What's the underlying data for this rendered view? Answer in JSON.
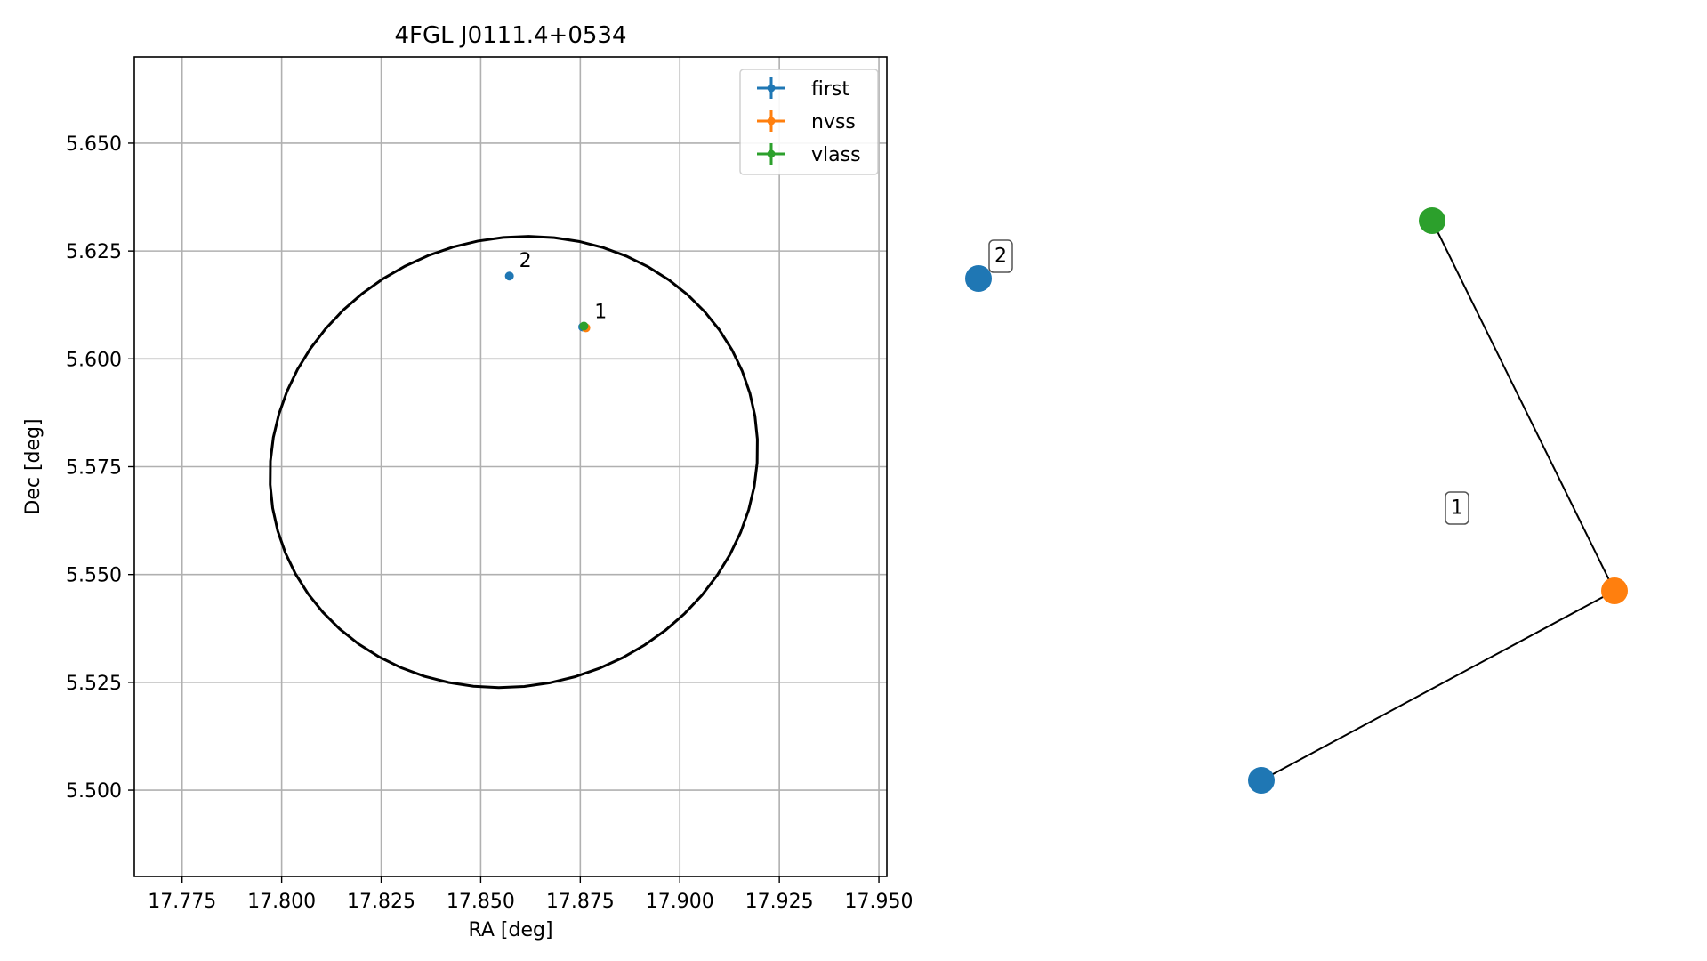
{
  "chart_data": [
    {
      "type": "scatter",
      "title": "4FGL J0111.4+0534",
      "xlabel": "RA [deg]",
      "ylabel": "Dec [deg]",
      "xlim": [
        17.763,
        17.952
      ],
      "ylim": [
        5.48,
        5.67
      ],
      "xticks": [
        17.775,
        17.8,
        17.825,
        17.85,
        17.875,
        17.9,
        17.925,
        17.95
      ],
      "xtick_labels": [
        "17.775",
        "17.800",
        "17.825",
        "17.850",
        "17.875",
        "17.900",
        "17.925",
        "17.950"
      ],
      "yticks": [
        5.5,
        5.525,
        5.55,
        5.575,
        5.6,
        5.625,
        5.65
      ],
      "ytick_labels": [
        "5.500",
        "5.525",
        "5.550",
        "5.575",
        "5.600",
        "5.625",
        "5.650"
      ],
      "grid": true,
      "legend_position": "top-right",
      "series": [
        {
          "name": "first",
          "color": "#1f77b4",
          "points": [
            {
              "x": 17.8572,
              "y": 5.6192
            },
            {
              "x": 17.8756,
              "y": 5.6074
            }
          ]
        },
        {
          "name": "nvss",
          "color": "#ff7f0e",
          "points": [
            {
              "x": 17.8764,
              "y": 5.6072
            }
          ]
        },
        {
          "name": "vlass",
          "color": "#2ca02c",
          "points": [
            {
              "x": 17.8759,
              "y": 5.6076
            }
          ]
        }
      ],
      "ellipse": {
        "center": {
          "x": 17.8583,
          "y": 5.5761
        },
        "semi_major_deg": 0.0615,
        "semi_minor_deg": 0.052,
        "position_angle_deg": 80,
        "color": "#000000"
      },
      "annotations": [
        {
          "text": "2",
          "x": 17.8572,
          "y": 5.6192
        },
        {
          "text": "1",
          "x": 17.8761,
          "y": 5.6074
        }
      ]
    },
    {
      "type": "network",
      "nodes": [
        {
          "id": "n2-first",
          "color": "#1f77b4"
        },
        {
          "id": "n1-vlass",
          "color": "#2ca02c"
        },
        {
          "id": "n1-nvss",
          "color": "#ff7f0e"
        },
        {
          "id": "n1-first",
          "color": "#1f77b4"
        }
      ],
      "edges": [
        {
          "from": "n1-vlass",
          "to": "n1-nvss"
        },
        {
          "from": "n1-nvss",
          "to": "n1-first"
        }
      ],
      "group_labels": [
        "2",
        "1"
      ]
    }
  ]
}
